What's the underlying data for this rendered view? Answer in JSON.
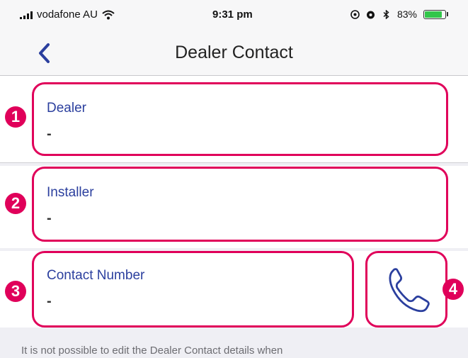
{
  "status_bar": {
    "carrier": "vodafone AU",
    "time": "9:31 pm",
    "battery": "83%",
    "battery_level": 0.83
  },
  "nav": {
    "title": "Dealer Contact",
    "back_icon": "chevron-left-icon"
  },
  "fields": {
    "dealer": {
      "label": "Dealer",
      "value": "-"
    },
    "installer": {
      "label": "Installer",
      "value": "-"
    },
    "contact": {
      "label": "Contact Number",
      "value": "-"
    }
  },
  "callouts": [
    "1",
    "2",
    "3",
    "4"
  ],
  "footer": {
    "note": "It is not possible to edit the Dealer Contact details when"
  },
  "colors": {
    "accent": "#2b3f9e",
    "highlight": "#e0005a",
    "battery": "#32c64a"
  }
}
